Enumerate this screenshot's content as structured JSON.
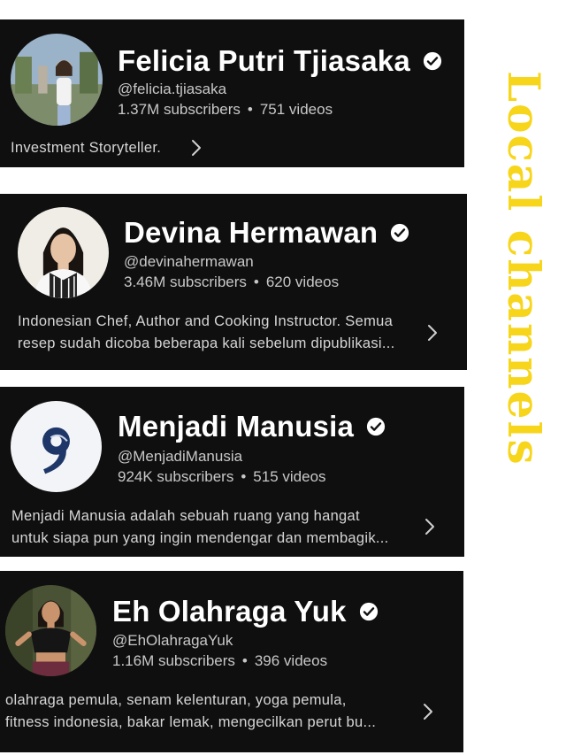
{
  "page_title": "Local channels",
  "colors": {
    "card_bg": "#0f0f0f",
    "accent_yellow": "#f7d51b"
  },
  "channels": [
    {
      "name": "Felicia Putri Tjiasaka",
      "handle": "@felicia.tjiasaka",
      "subscribers": "1.37M subscribers",
      "videos": "751 videos",
      "description_lines": [
        "Investment Storyteller."
      ],
      "avatar_icon": "person-photo-avatar"
    },
    {
      "name": "Devina Hermawan",
      "handle": "@devinahermawan",
      "subscribers": "3.46M subscribers",
      "videos": "620 videos",
      "description_lines": [
        "Indonesian Chef, Author and Cooking Instructor. Semua",
        "resep sudah dicoba beberapa kali sebelum dipublikasi..."
      ],
      "avatar_icon": "person-photo-avatar"
    },
    {
      "name": "Menjadi Manusia",
      "handle": "@MenjadiManusia",
      "subscribers": "924K subscribers",
      "videos": "515 videos",
      "description_lines": [
        "Menjadi Manusia adalah sebuah ruang yang hangat",
        "untuk siapa pun yang ingin mendengar dan membagik..."
      ],
      "avatar_icon": "logo-avatar"
    },
    {
      "name": "Eh Olahraga Yuk",
      "handle": "@EhOlahragaYuk",
      "subscribers": "1.16M subscribers",
      "videos": "396 videos",
      "description_lines": [
        "olahraga pemula, senam kelenturan, yoga pemula,",
        "fitness indonesia, bakar lemak, mengecilkan perut bu..."
      ],
      "avatar_icon": "person-photo-avatar"
    }
  ]
}
